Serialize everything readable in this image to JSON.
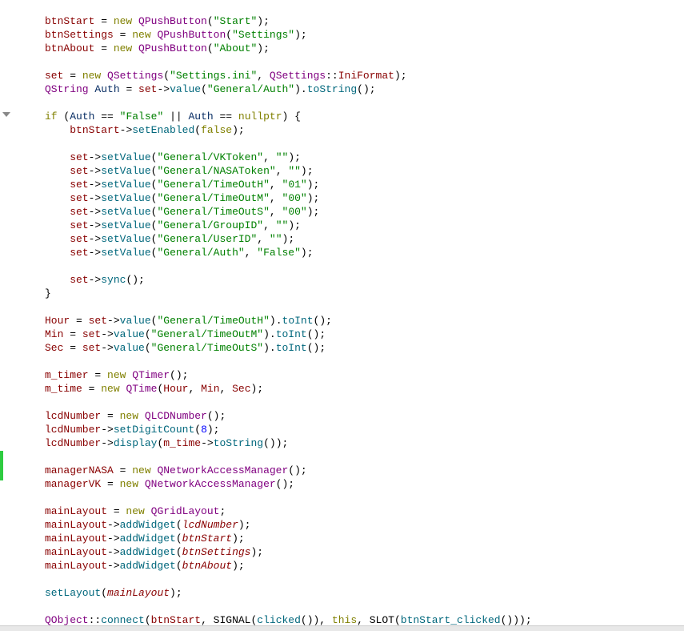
{
  "code": {
    "l01_a": "btnStart",
    "l01_b": "new",
    "l01_c": "QPushButton",
    "l01_d": "\"Start\"",
    "l02_a": "btnSettings",
    "l02_b": "new",
    "l02_c": "QPushButton",
    "l02_d": "\"Settings\"",
    "l03_a": "btnAbout",
    "l03_b": "new",
    "l03_c": "QPushButton",
    "l03_d": "\"About\"",
    "l05_a": "set",
    "l05_b": "new",
    "l05_c": "QSettings",
    "l05_d": "\"Settings.ini\"",
    "l05_e": "QSettings",
    "l05_f": "IniFormat",
    "l06_a": "QString",
    "l06_b": "Auth",
    "l06_c": "set",
    "l06_d": "value",
    "l06_e": "\"General/Auth\"",
    "l06_f": "toString",
    "l08_a": "if",
    "l08_b": "Auth",
    "l08_c": "\"False\"",
    "l08_d": "Auth",
    "l08_e": "nullptr",
    "l09_a": "btnStart",
    "l09_b": "setEnabled",
    "l09_c": "false",
    "l11_a": "set",
    "l11_b": "setValue",
    "l11_c": "\"General/VKToken\"",
    "l11_d": "\"\"",
    "l12_a": "set",
    "l12_b": "setValue",
    "l12_c": "\"General/NASAToken\"",
    "l12_d": "\"\"",
    "l13_a": "set",
    "l13_b": "setValue",
    "l13_c": "\"General/TimeOutH\"",
    "l13_d": "\"01\"",
    "l14_a": "set",
    "l14_b": "setValue",
    "l14_c": "\"General/TimeOutM\"",
    "l14_d": "\"00\"",
    "l15_a": "set",
    "l15_b": "setValue",
    "l15_c": "\"General/TimeOutS\"",
    "l15_d": "\"00\"",
    "l16_a": "set",
    "l16_b": "setValue",
    "l16_c": "\"General/GroupID\"",
    "l16_d": "\"\"",
    "l17_a": "set",
    "l17_b": "setValue",
    "l17_c": "\"General/UserID\"",
    "l17_d": "\"\"",
    "l18_a": "set",
    "l18_b": "setValue",
    "l18_c": "\"General/Auth\"",
    "l18_d": "\"False\"",
    "l20_a": "set",
    "l20_b": "sync",
    "l23_a": "Hour",
    "l23_b": "set",
    "l23_c": "value",
    "l23_d": "\"General/TimeOutH\"",
    "l23_e": "toInt",
    "l24_a": "Min",
    "l24_b": "set",
    "l24_c": "value",
    "l24_d": "\"General/TimeOutM\"",
    "l24_e": "toInt",
    "l25_a": "Sec",
    "l25_b": "set",
    "l25_c": "value",
    "l25_d": "\"General/TimeOutS\"",
    "l25_e": "toInt",
    "l27_a": "m_timer",
    "l27_b": "new",
    "l27_c": "QTimer",
    "l28_a": "m_time",
    "l28_b": "new",
    "l28_c": "QTime",
    "l28_d": "Hour",
    "l28_e": "Min",
    "l28_f": "Sec",
    "l30_a": "lcdNumber",
    "l30_b": "new",
    "l30_c": "QLCDNumber",
    "l31_a": "lcdNumber",
    "l31_b": "setDigitCount",
    "l31_c": "8",
    "l32_a": "lcdNumber",
    "l32_b": "display",
    "l32_c": "m_time",
    "l32_d": "toString",
    "l34_a": "managerNASA",
    "l34_b": "new",
    "l34_c": "QNetworkAccessManager",
    "l35_a": "managerVK",
    "l35_b": "new",
    "l35_c": "QNetworkAccessManager",
    "l37_a": "mainLayout",
    "l37_b": "new",
    "l37_c": "QGridLayout",
    "l38_a": "mainLayout",
    "l38_b": "addWidget",
    "l38_c": "lcdNumber",
    "l39_a": "mainLayout",
    "l39_b": "addWidget",
    "l39_c": "btnStart",
    "l40_a": "mainLayout",
    "l40_b": "addWidget",
    "l40_c": "btnSettings",
    "l41_a": "mainLayout",
    "l41_b": "addWidget",
    "l41_c": "btnAbout",
    "l43_a": "setLayout",
    "l43_b": "mainLayout",
    "l45_a": "QObject",
    "l45_b": "connect",
    "l45_c": "btnStart",
    "l45_d": "SIGNAL",
    "l45_e": "clicked",
    "l45_f": "this",
    "l45_g": "SLOT",
    "l45_h": "btnStart_clicked"
  }
}
